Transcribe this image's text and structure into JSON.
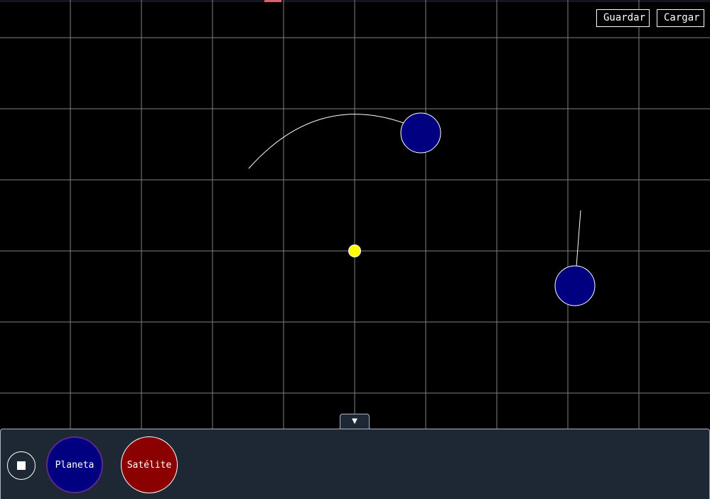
{
  "toolbar": {
    "save_label": "Guardar",
    "load_label": "Cargar"
  },
  "panel": {
    "toggle_icon": "▼",
    "stop_icon": "stop-icon",
    "tools": [
      {
        "label": "Planeta",
        "color": "#000080"
      },
      {
        "label": "Satélite",
        "color": "#8b0000"
      }
    ]
  },
  "simulation": {
    "background": "#000000",
    "grid_color": "#808080",
    "sun_color": "#ffff00",
    "planet_color": "#000080",
    "trail_color": "#ffffff",
    "bodies": [
      {
        "type": "sun"
      },
      {
        "type": "planet"
      },
      {
        "type": "planet"
      }
    ]
  }
}
